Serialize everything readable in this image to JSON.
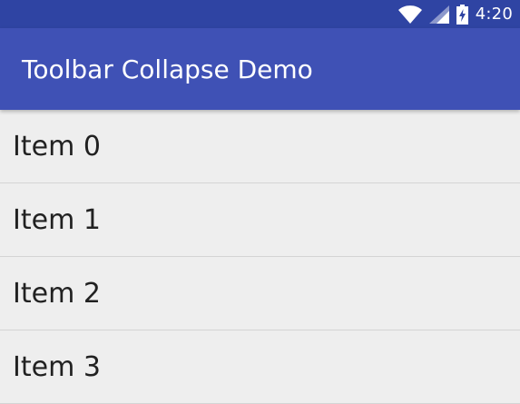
{
  "status_bar": {
    "time": "4:20",
    "icons": [
      "wifi-icon",
      "signal-icon",
      "battery-charging-icon"
    ],
    "background": "#2f44a3"
  },
  "toolbar": {
    "title": "Toolbar Collapse Demo",
    "background": "#3f51b5"
  },
  "list": {
    "items": [
      {
        "label": "Item 0"
      },
      {
        "label": "Item 1"
      },
      {
        "label": "Item 2"
      },
      {
        "label": "Item 3"
      }
    ]
  }
}
